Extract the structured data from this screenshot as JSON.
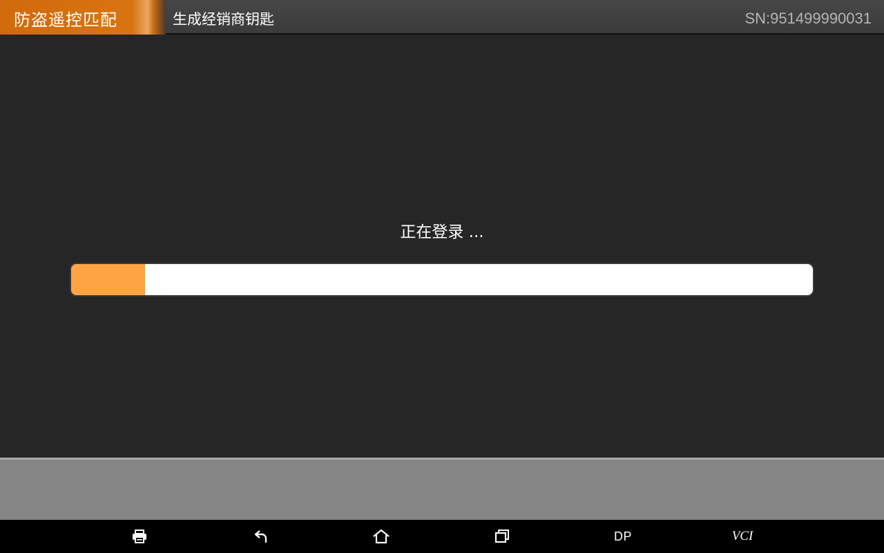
{
  "header": {
    "app_title": "防盗遥控匹配",
    "page_title": "生成经销商钥匙",
    "serial": "SN:951499990031"
  },
  "main": {
    "status_text": "正在登录 ...",
    "progress_percent": 10
  },
  "navbar": {
    "items": [
      {
        "icon": "print-icon"
      },
      {
        "icon": "back-icon"
      },
      {
        "icon": "home-icon"
      },
      {
        "icon": "recent-apps-icon"
      },
      {
        "label": "DP"
      },
      {
        "label": "VCI"
      }
    ]
  },
  "colors": {
    "accent": "#d87410",
    "progress_fill": "#ffa444",
    "background": "#262626"
  }
}
